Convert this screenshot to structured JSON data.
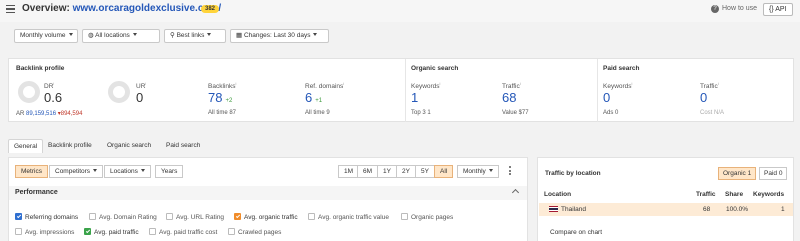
{
  "header": {
    "overview_label": "Overview:",
    "domain": "www.orcaragoldexclusive.com/",
    "badge": "382",
    "how_to_use": "How to use",
    "api": "{} API"
  },
  "filters": {
    "volume": "Monthly volume",
    "locations": "All locations",
    "links": "Best links",
    "changes": "Changes: Last 30 days"
  },
  "backlink_profile": {
    "title": "Backlink profile",
    "dr_label": "DR",
    "dr_value": "0.6",
    "ar_label": "AR",
    "ar_value": "89,159,516",
    "ar_delta": "▾894,594",
    "ur_label": "UR",
    "ur_value": "0",
    "backlinks_label": "Backlinks",
    "backlinks_value": "78",
    "backlinks_delta": "+2",
    "backlinks_alltime": "All time 87",
    "refdomains_label": "Ref. domains",
    "refdomains_value": "6",
    "refdomains_delta": "+1",
    "refdomains_alltime": "All time 9"
  },
  "organic_search": {
    "title": "Organic search",
    "keywords_label": "Keywords",
    "keywords_value": "1",
    "top3": "Top 3  1",
    "traffic_label": "Traffic",
    "traffic_value": "68",
    "value": "Value $77"
  },
  "paid_search": {
    "title": "Paid search",
    "keywords_label": "Keywords",
    "keywords_value": "0",
    "ads": "Ads  0",
    "traffic_label": "Traffic",
    "traffic_value": "0",
    "cost": "Cost  N/A"
  },
  "tabs": [
    "General",
    "Backlink profile",
    "Organic search",
    "Paid search"
  ],
  "chart_controls": {
    "segments": [
      "Metrics",
      "Competitors",
      "Locations",
      "Years"
    ],
    "periods": [
      "1M",
      "6M",
      "1Y",
      "2Y",
      "5Y",
      "All"
    ],
    "interval": "Monthly"
  },
  "performance": {
    "title": "Performance",
    "checkboxes": [
      {
        "label": "Referring domains",
        "checked": true
      },
      {
        "label": "Avg. Domain Rating",
        "checked": false
      },
      {
        "label": "Avg. URL Rating",
        "checked": false
      },
      {
        "label": "Avg. organic traffic",
        "checked": true
      },
      {
        "label": "Avg. organic traffic value",
        "checked": false
      },
      {
        "label": "Organic pages",
        "checked": false
      },
      {
        "label": "Avg. impressions",
        "checked": false
      },
      {
        "label": "Avg. paid traffic",
        "checked": true
      },
      {
        "label": "Avg. paid traffic cost",
        "checked": false
      },
      {
        "label": "Crawled pages",
        "checked": false
      }
    ]
  },
  "traffic_by_location": {
    "title": "Traffic by location",
    "toggle": [
      "Organic 1",
      "Paid 0"
    ],
    "columns": [
      "Location",
      "Traffic",
      "Share",
      "Keywords"
    ],
    "rows": [
      {
        "location": "Thailand",
        "traffic": "68",
        "share": "100.0%",
        "keywords": "1"
      }
    ],
    "compare": "Compare on chart"
  },
  "colors": {
    "accent_blue": "#2457b8",
    "badge_yellow": "#ffd43b",
    "active_orange": "#ffe6c8",
    "check_blue": "#2f6fd0",
    "check_orange": "#f08c2a",
    "check_green": "#3aa34a"
  },
  "icons": [
    "menu-icon",
    "help-icon",
    "caret-down-icon",
    "globe-icon",
    "link-icon",
    "calendar-icon",
    "chevron-up-icon",
    "more-vertical-icon",
    "thailand-flag-icon"
  ]
}
